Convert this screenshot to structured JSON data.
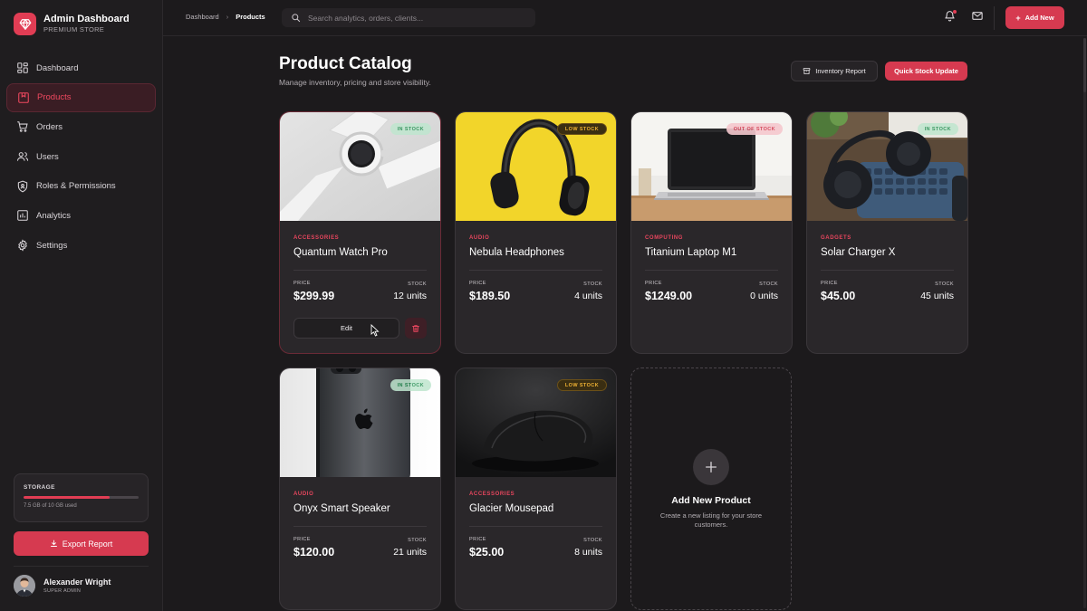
{
  "brand": {
    "title": "Admin Dashboard",
    "subtitle": "PREMIUM STORE",
    "logo_icon": "diamond-icon"
  },
  "nav": {
    "items": [
      {
        "label": "Dashboard",
        "icon": "grid-icon",
        "active": false
      },
      {
        "label": "Products",
        "icon": "box-icon",
        "active": true
      },
      {
        "label": "Orders",
        "icon": "cart-icon",
        "active": false
      },
      {
        "label": "Users",
        "icon": "users-icon",
        "active": false
      },
      {
        "label": "Roles & Permissions",
        "icon": "shield-icon",
        "active": false
      },
      {
        "label": "Analytics",
        "icon": "chart-icon",
        "active": false
      },
      {
        "label": "Settings",
        "icon": "gear-icon",
        "active": false
      }
    ]
  },
  "storage": {
    "title": "STORAGE",
    "text": "7.5 GB of 10 GB used",
    "fraction": 0.75
  },
  "export": {
    "label": "Export Report"
  },
  "user": {
    "name": "Alexander Wright",
    "role": "SUPER ADMIN"
  },
  "topbar": {
    "breadcrumb": [
      "Dashboard",
      "Products"
    ],
    "search_placeholder": "Search analytics, orders, clients...",
    "add_new_label": "Add New"
  },
  "page": {
    "title": "Product Catalog",
    "subtitle": "Manage inventory, pricing and store visibility.",
    "inventory_report_label": "Inventory Report",
    "quick_stock_label": "Quick Stock Update"
  },
  "products": [
    {
      "category": "ACCESSORIES",
      "name": "Quantum Watch Pro",
      "price_label": "PRICE",
      "price": "$299.99",
      "stock_label": "STOCK",
      "stock": "12 units",
      "badge": "IN STOCK",
      "status": "in"
    },
    {
      "category": "AUDIO",
      "name": "Nebula Headphones",
      "price_label": "PRICE",
      "price": "$189.50",
      "stock_label": "STOCK",
      "stock": "4 units",
      "badge": "LOW STOCK",
      "status": "low"
    },
    {
      "category": "COMPUTING",
      "name": "Titanium Laptop M1",
      "price_label": "PRICE",
      "price": "$1249.00",
      "stock_label": "STOCK",
      "stock": "0 units",
      "badge": "OUT OF STOCK",
      "status": "out"
    },
    {
      "category": "GADGETS",
      "name": "Solar Charger X",
      "price_label": "PRICE",
      "price": "$45.00",
      "stock_label": "STOCK",
      "stock": "45 units",
      "badge": "IN STOCK",
      "status": "in"
    },
    {
      "category": "AUDIO",
      "name": "Onyx Smart Speaker",
      "price_label": "PRICE",
      "price": "$120.00",
      "stock_label": "STOCK",
      "stock": "21 units",
      "badge": "IN STOCK",
      "status": "in"
    },
    {
      "category": "ACCESSORIES",
      "name": "Glacier Mousepad",
      "price_label": "PRICE",
      "price": "$25.00",
      "stock_label": "STOCK",
      "stock": "8 units",
      "badge": "LOW STOCK",
      "status": "low"
    }
  ],
  "card_actions": {
    "edit_label": "Edit",
    "delete_icon": "trash-icon"
  },
  "add_card": {
    "title": "Add New Product",
    "description": "Create a new listing for your store customers."
  },
  "colors": {
    "accent": "#d63a50",
    "background": "#1c1a1c",
    "card": "#2a272a",
    "in_stock": "#1f8a4d",
    "low_stock": "#f0b233",
    "out_of_stock": "#d23a4f"
  }
}
